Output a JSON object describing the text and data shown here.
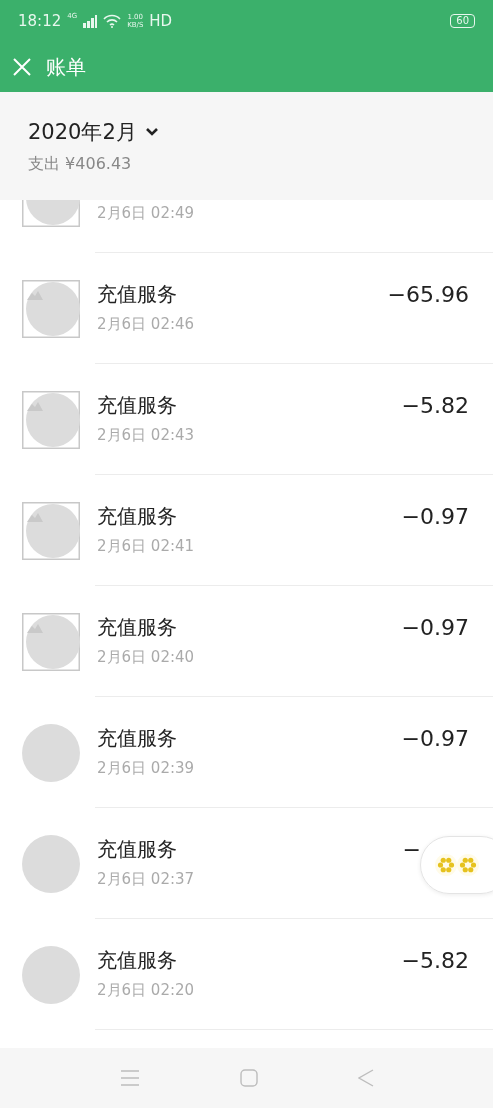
{
  "status_bar": {
    "time": "18:12",
    "network": "4G",
    "speed_value": "1.00",
    "speed_unit": "KB/S",
    "hd": "HD",
    "battery": "60"
  },
  "header": {
    "title": "账单"
  },
  "summary": {
    "month": "2020年2月",
    "expense": "支出 ¥406.43"
  },
  "transactions": [
    {
      "kind": "image-placeholder",
      "time": "2月6日 02:49"
    },
    {
      "kind": "image-placeholder",
      "title": "充值服务",
      "time": "2月6日 02:46",
      "amount": "−65.96"
    },
    {
      "kind": "image-placeholder",
      "title": "充值服务",
      "time": "2月6日 02:43",
      "amount": "−5.82"
    },
    {
      "kind": "image-placeholder",
      "title": "充值服务",
      "time": "2月6日 02:41",
      "amount": "−0.97"
    },
    {
      "kind": "image-placeholder",
      "title": "充值服务",
      "time": "2月6日 02:40",
      "amount": "−0.97"
    },
    {
      "kind": "circle",
      "title": "充值服务",
      "time": "2月6日 02:39",
      "amount": "−0.97"
    },
    {
      "kind": "circle",
      "title": "充值服务",
      "time": "2月6日 02:37",
      "amount": "−",
      "obscured": true
    },
    {
      "kind": "circle",
      "title": "充值服务",
      "time": "2月6日 02:20",
      "amount": "−5.82"
    }
  ]
}
